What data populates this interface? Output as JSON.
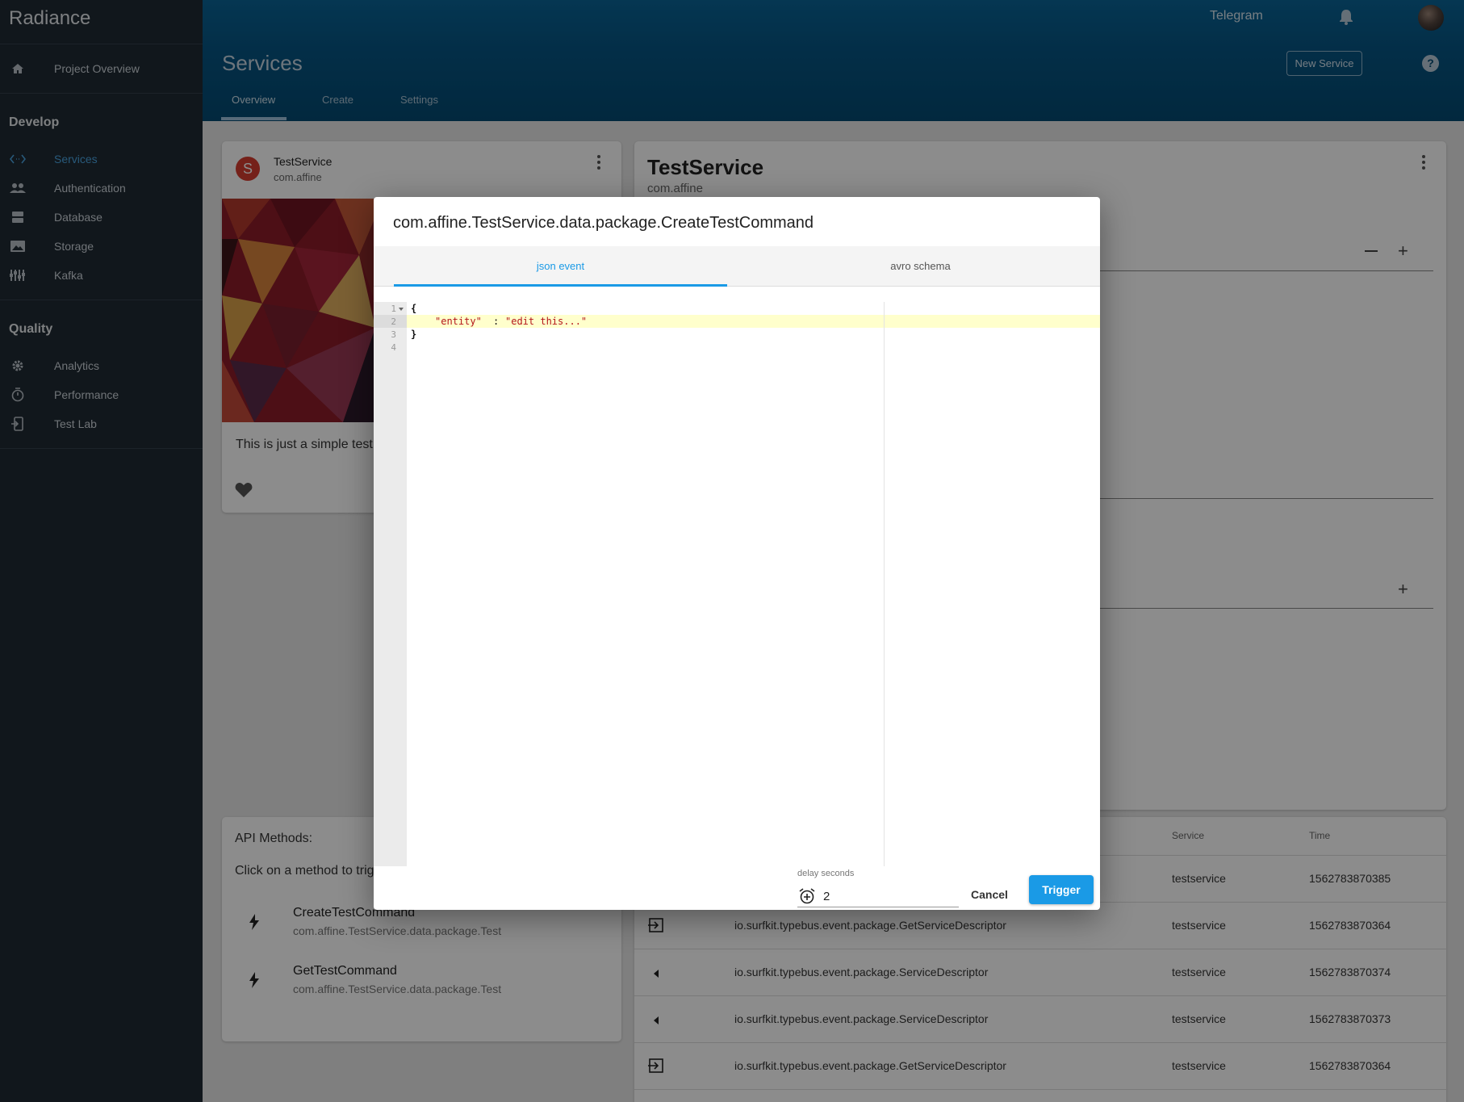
{
  "app": {
    "name": "Radiance"
  },
  "sidebar": {
    "project_overview": "Project Overview",
    "develop": {
      "heading": "Develop",
      "items": [
        {
          "label": "Services",
          "icon": "code-icon",
          "active": true
        },
        {
          "label": "Authentication",
          "icon": "people-icon"
        },
        {
          "label": "Database",
          "icon": "database-icon"
        },
        {
          "label": "Storage",
          "icon": "image-icon"
        },
        {
          "label": "Kafka",
          "icon": "kafka-icon"
        }
      ]
    },
    "quality": {
      "heading": "Quality",
      "items": [
        {
          "label": "Analytics",
          "icon": "gear-icon"
        },
        {
          "label": "Performance",
          "icon": "timer-icon"
        },
        {
          "label": "Test Lab",
          "icon": "phone-icon"
        }
      ]
    }
  },
  "header": {
    "telegram": "Telegram",
    "page_title": "Services",
    "new_service": "New Service",
    "help": "?",
    "tabs": [
      "Overview",
      "Create",
      "Settings"
    ],
    "active_tab": "Overview"
  },
  "service_card": {
    "avatar_letter": "S",
    "name": "TestService",
    "namespace": "com.affine",
    "description": "This is just a simple test"
  },
  "detail_card": {
    "title": "TestService",
    "subtitle": "com.affine"
  },
  "api_card": {
    "title": "API Methods:",
    "hint": "Click on a method to trigger",
    "methods": [
      {
        "name": "CreateTestCommand",
        "type": "com.affine.TestService.data.package.Test"
      },
      {
        "name": "GetTestCommand",
        "type": "com.affine.TestService.data.package.Test"
      }
    ]
  },
  "events_table": {
    "columns": [
      "Service",
      "Time"
    ],
    "rows": [
      {
        "icon": "unknown",
        "event": "",
        "service": "testservice",
        "time": "1562783870385"
      },
      {
        "icon": "input-icon",
        "event": "io.surfkit.typebus.event.package.GetServiceDescriptor",
        "service": "testservice",
        "time": "1562783870364"
      },
      {
        "icon": "arrow-left-icon",
        "event": "io.surfkit.typebus.event.package.ServiceDescriptor",
        "service": "testservice",
        "time": "1562783870374"
      },
      {
        "icon": "arrow-left-icon",
        "event": "io.surfkit.typebus.event.package.ServiceDescriptor",
        "service": "testservice",
        "time": "1562783870373"
      },
      {
        "icon": "input-icon",
        "event": "io.surfkit.typebus.event.package.GetServiceDescriptor",
        "service": "testservice",
        "time": "1562783870364"
      }
    ]
  },
  "dialog": {
    "title": "com.affine.TestService.data.package.CreateTestCommand",
    "tabs": [
      "json event",
      "avro schema"
    ],
    "active_tab": "json event",
    "line_numbers": [
      "1",
      "2",
      "3",
      "4"
    ],
    "code": {
      "line1": "{",
      "key": "\"entity\"",
      "colon": ": ",
      "value": "\"edit this...\"",
      "line3": "}"
    },
    "delay_label": "delay seconds",
    "delay_value": "2",
    "cancel": "Cancel",
    "trigger": "Trigger"
  },
  "colors": {
    "accent": "#1a9ae6",
    "topbar": "#075583",
    "sidebar": "#1f2a33"
  }
}
